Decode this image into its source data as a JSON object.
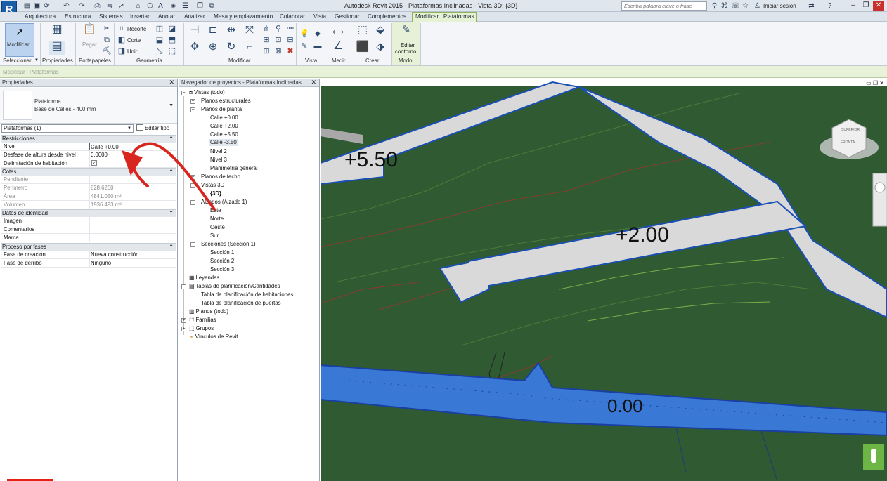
{
  "app": {
    "logo": "R",
    "title": "Autodesk Revit 2015 -     Plataformas Inclinadas - Vista 3D: {3D}",
    "search_placeholder": "Escriba palabra clave o frase",
    "signin": "Iniciar sesión"
  },
  "menu": {
    "tabs": [
      "Arquitectura",
      "Estructura",
      "Sistemas",
      "Insertar",
      "Anotar",
      "Analizar",
      "Masa y emplazamiento",
      "Colaborar",
      "Vista",
      "Gestionar",
      "Complementos"
    ],
    "active_tab": "Modificar | Plataformas"
  },
  "ribbon": {
    "modify_label": "Modificar",
    "paste_label": "Pegar",
    "recorte_label": "Recorte",
    "corte_label": "Corte",
    "unir_label": "Unir",
    "edit_contour_label_1": "Editar",
    "edit_contour_label_2": "contorno",
    "panels": {
      "seleccionar": "Seleccionar",
      "propiedades": "Propiedades",
      "portapapeles": "Portapapeles",
      "geometria": "Geometría",
      "modificar": "Modificar",
      "vista": "Vista",
      "medir": "Medir",
      "crear": "Crear",
      "modo": "Modo"
    }
  },
  "options_bar": {
    "label": "Modificar | Plataformas"
  },
  "properties": {
    "header": "Propiedades",
    "type_name": "Plataforma",
    "type_sub": "Base de Calles - 400 mm",
    "instance_selector": "Plataformas (1)",
    "edit_type": "Editar tipo",
    "groups": {
      "restricciones": "Restricciones",
      "cotas": "Cotas",
      "identidad": "Datos de identidad",
      "fases": "Proceso por fases"
    },
    "rows": {
      "nivel": {
        "k": "Nivel",
        "v": "Calle +0.00"
      },
      "desfase": {
        "k": "Desfase de altura desde nivel",
        "v": "0.0000"
      },
      "delimitacion": {
        "k": "Delimitación de habitación",
        "v": "✓"
      },
      "pendiente": {
        "k": "Pendiente",
        "v": ""
      },
      "perimetro": {
        "k": "Perímetro",
        "v": "828.6260"
      },
      "area": {
        "k": "Área",
        "v": "4841.050 m²"
      },
      "volumen": {
        "k": "Volumen",
        "v": "1936.493 m³"
      },
      "imagen": {
        "k": "Imagen",
        "v": ""
      },
      "comentarios": {
        "k": "Comentarios",
        "v": ""
      },
      "marca": {
        "k": "Marca",
        "v": ""
      },
      "fase_creacion": {
        "k": "Fase de creación",
        "v": "Nueva construcción"
      },
      "fase_derribo": {
        "k": "Fase de derribo",
        "v": "Ninguno"
      }
    }
  },
  "browser": {
    "header": "Navegador de proyectos - Plataformas Inclinadas",
    "items": {
      "vistas": "Vistas (todo)",
      "planos_estructurales": "Planos estructurales",
      "planos_planta": "Planos de planta",
      "calle_000": "Calle +0.00",
      "calle_200": "Calle +2.00",
      "calle_550": "Calle +5.50",
      "calle_m350": "Calle -3.50",
      "nivel2": "Nivel 2",
      "nivel3": "Nivel 3",
      "planimetria": "Planimetría general",
      "planos_techo": "Planos de techo",
      "vistas3d": "Vistas 3D",
      "v3d": "{3D}",
      "alzados": "Alzados (Alzado 1)",
      "este": "Este",
      "norte": "Norte",
      "oeste": "Oeste",
      "sur": "Sur",
      "secciones": "Secciones (Sección 1)",
      "seccion1": "Sección 1",
      "seccion2": "Sección 2",
      "seccion3": "Sección 3",
      "leyendas": "Leyendas",
      "tablas": "Tablas de planificación/Cantidades",
      "tabla_hab": "Tabla de planificación de habitaciones",
      "tabla_puertas": "Tabla de planificación de puertas",
      "planos": "Planos (todo)",
      "familias": "Familias",
      "grupos": "Grupos",
      "vinculos": "Vínculos de Revit"
    }
  },
  "viewport": {
    "labels": {
      "top": "+5.50",
      "mid": "+2.00",
      "bottom": "0.00"
    },
    "viewcube": {
      "top": "SUPERIOR",
      "front": "FRONTAL"
    }
  },
  "colors": {
    "terrain": "#2f5a32",
    "pad_grey": "#d9d9d9",
    "pad_selected": "#3a78d6",
    "annotation_arrow": "#d8261f"
  }
}
